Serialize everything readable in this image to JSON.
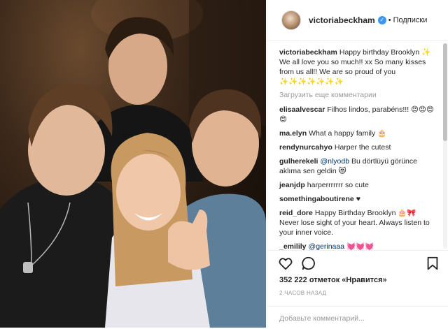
{
  "header": {
    "username": "victoriabeckham",
    "verified_glyph": "✓",
    "separator": "•",
    "follow_label": "Подписки"
  },
  "caption": {
    "username": "victoriabeckham",
    "text": "Happy birthday Brooklyn ✨ We all love you so much!! xx So many kisses from us all!! We are so proud of you ✨✨✨✨✨✨✨"
  },
  "load_more": "Загрузить еще комментарии",
  "comments": [
    {
      "username": "elisaalvescar",
      "text": "Filhos lindos, parabéns!!! 😍😍😍😍"
    },
    {
      "username": "ma.elyn",
      "text": "What a happy family 🎂"
    },
    {
      "username": "rendynurcahyo",
      "text": "Harper the cutest"
    },
    {
      "username": "gulherekeli",
      "mention": "@nlyodb",
      "text": " Bu dörtlüyü görünce aklıma sen geldin 😻"
    },
    {
      "username": "jeanjdp",
      "text": "harperrrrrrr so cute"
    },
    {
      "username": "somethingaboutirene",
      "text": "♥"
    },
    {
      "username": "reid_dore",
      "text": "Happy Birthday Brooklyn 🎂🎀 Never lose sight of your heart. Always listen to your inner voice."
    },
    {
      "username": "_emilily",
      "mention": "@gerinaaa",
      "text": " 💓💓💓"
    }
  ],
  "likes": "352 222 отметок «Нравится»",
  "timestamp": "2 ЧАСОВ НАЗАД",
  "add_comment_placeholder": "Добавьте комментарий...",
  "icons": [
    "heart-icon",
    "comment-icon",
    "bookmark-icon"
  ]
}
